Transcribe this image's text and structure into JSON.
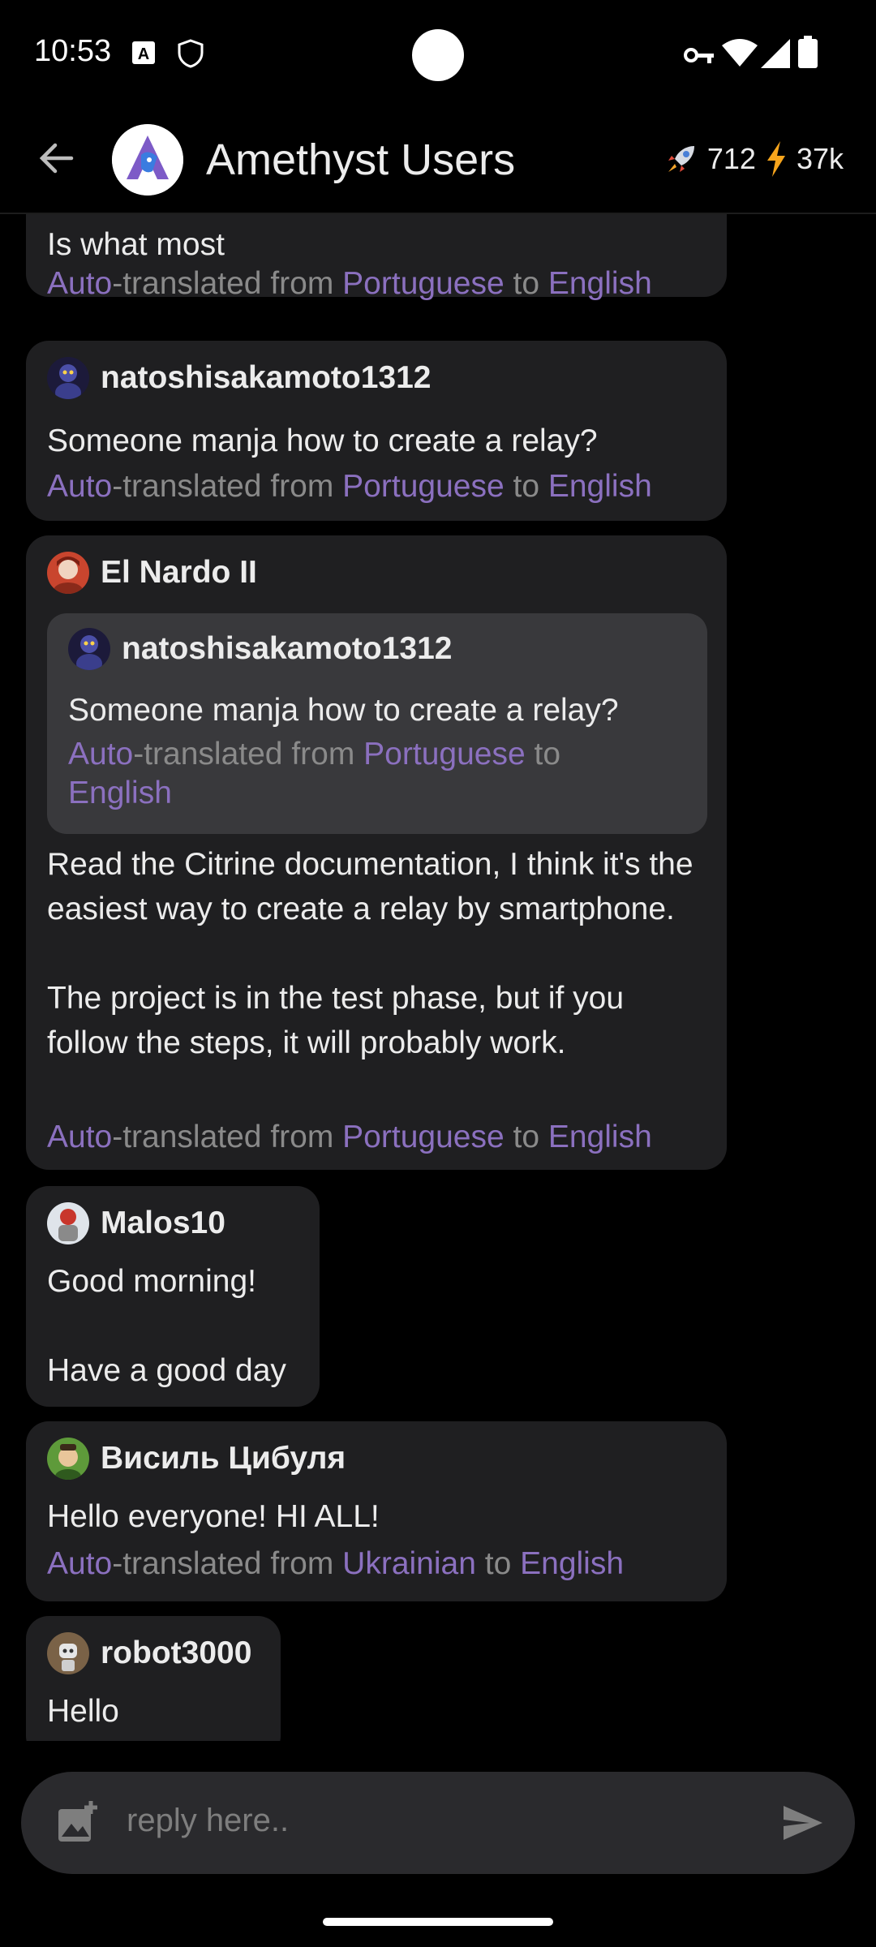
{
  "status_bar": {
    "time": "10:53"
  },
  "header": {
    "title": "Amethyst Users",
    "relay_count": "712",
    "zap_total": "37k"
  },
  "translation": {
    "prefix": "Auto",
    "mid": "-translated from ",
    "to": " to ",
    "target": "English"
  },
  "messages": [
    {
      "text": "Is what most",
      "source_lang": "Portuguese"
    },
    {
      "author": "natoshisakamoto1312",
      "text": "Someone manja how to create a relay?",
      "source_lang": "Portuguese"
    },
    {
      "author": "El Nardo II",
      "quote": {
        "author": "natoshisakamoto1312",
        "text": "Someone manja how to create a relay?",
        "source_lang": "Portuguese"
      },
      "text": "Read the Citrine documentation, I think it's the easiest way to create a relay by smartphone.\n\nThe project is in the test phase, but if you follow the steps, it will probably work.",
      "source_lang": "Portuguese"
    },
    {
      "author": "Malos10",
      "text": "Good morning!\n\nHave a good day"
    },
    {
      "author": "Висиль Цибуля",
      "text": "Hello everyone! HI ALL!",
      "source_lang": "Ukrainian"
    },
    {
      "author": "robot3000",
      "text": "Hello"
    }
  ],
  "composer": {
    "placeholder": "reply here.."
  },
  "colors": {
    "accent": "#8b70bf",
    "bubble": "#1f1f21",
    "quote": "#39393c"
  }
}
